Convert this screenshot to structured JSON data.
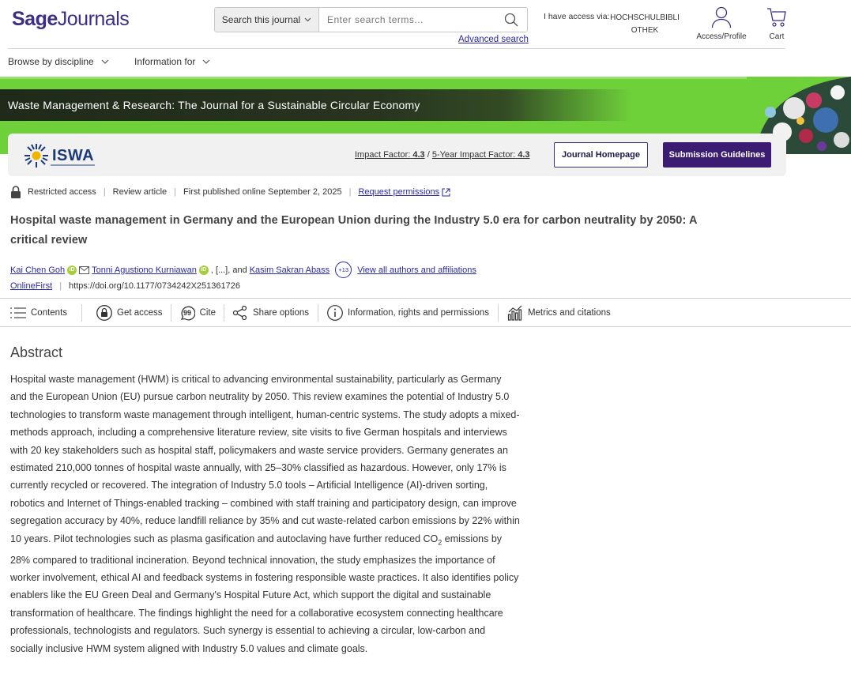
{
  "header": {
    "logo_part1": "Sage",
    "logo_part2": "Journals",
    "search_scope": "Search this journal",
    "search_placeholder": "Enter search terms...",
    "advanced_search": "Advanced search",
    "access_label": "I have access via:",
    "access_institution": "HOCHSCHULBIBLIOTHEK",
    "profile_label": "Access/Profile",
    "cart_label": "Cart"
  },
  "nav": {
    "browse": "Browse by discipline",
    "info": "Information for"
  },
  "banner": {
    "journal_title": "Waste Management & Research: The Journal for a Sustainable Circular Economy",
    "logo_text": "ISWA",
    "impact_label": "Impact Factor:",
    "impact_value": "4.3",
    "five_year_label": "5-Year Impact Factor:",
    "five_year_value": "4.3",
    "journal_homepage": "Journal Homepage",
    "submission_guidelines": "Submission Guidelines"
  },
  "article": {
    "access": "Restricted access",
    "type": "Review article",
    "published": "First published online September 2, 2025",
    "permissions": "Request permissions",
    "title": "Hospital waste management in Germany and the European Union during the Industry 5.0 era for carbon neutrality by 2050: A critical review",
    "author1": "Kai Chen Goh",
    "author2": "Tonni Agustiono Kurniawan",
    "ellipsis": ", [...], and",
    "author3": "Kasim Sakran Abass",
    "more_authors": "+13",
    "view_all": "View all authors and affiliations",
    "issue": "OnlineFirst",
    "doi": "https://doi.org/10.1177/0734242X251361726"
  },
  "toolbar": {
    "contents": "Contents",
    "get_access": "Get access",
    "cite": "Cite",
    "share": "Share options",
    "info": "Information, rights and permissions",
    "metrics": "Metrics and citations"
  },
  "abstract": {
    "heading": "Abstract",
    "text_part1": "Hospital waste management (HWM) is critical to advancing environmental sustainability, particularly as Germany and the European Union (EU) pursue carbon neutrality by 2050. This review examines the potential of Industry 5.0 technologies to transform waste management through intelligent, human-centric systems. The study adopts a mixed-methods approach, including a comprehensive literature review, site visits to five German hospitals and interviews with 20 key stakeholders such as hospital staff, policymakers and waste service providers. Germany generates an estimated 210,000 tonnes of hospital waste annually, with 25–30% classified as hazardous. However, only 17% is currently recycled or recovered. The integration of Industry 5.0 tools – Artificial Intelligence (AI)-driven sorting, robotics and Internet of Things-enabled tracking – combined with staff training and participatory design, can improve segregation accuracy by 40%, reduce landfill reliance by 35% and cut waste-related carbon emissions by 22% within 10 years. Pilot technologies such as plasma gasification and autoclaving have further reduced CO",
    "text_sub": "2",
    "text_part2": " emissions by 28% compared to traditional incineration. Beyond technical innovation, the study emphasizes the importance of worker involvement, ethical AI and feedback systems in fostering responsible waste practices. It also identifies policy enablers like the EU Green Deal and Germany's Hospital Future Act, which support the digital and sustainable transformation of healthcare. The findings highlight the need for a collaborative ecosystem connecting healthcare professionals, technologists and regulators. Such synergy is essential to achieving a circular, low-carbon and socially inclusive HWM system aligned with Industry 5.0 values and climate goals."
  }
}
